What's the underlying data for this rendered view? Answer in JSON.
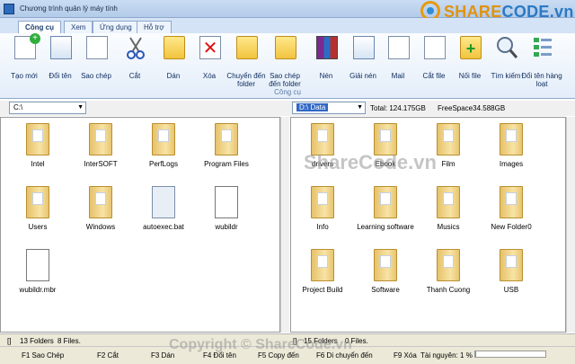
{
  "window": {
    "title": "Chương trình quản lý máy tính"
  },
  "logo": {
    "part1": "SHARE",
    "part2": "CODE",
    "part3": ".vn"
  },
  "tabs": [
    "Công cụ",
    "Xem",
    "Ứng dụng",
    "Hỗ trợ"
  ],
  "ribbon": {
    "group_label": "Công cụ",
    "buttons": [
      {
        "label": "Tạo mới",
        "icon": "new-document-icon"
      },
      {
        "label": "Đổi tên",
        "icon": "rename-icon"
      },
      {
        "label": "Sao chép",
        "icon": "copy-icon"
      },
      {
        "label": "Cắt",
        "icon": "scissors-icon"
      },
      {
        "label": "Dán",
        "icon": "paste-icon"
      },
      {
        "label": "Xóa",
        "icon": "delete-icon"
      },
      {
        "label": "Chuyển đến folder",
        "icon": "move-to-folder-icon"
      },
      {
        "label": "Sao chép đến folder",
        "icon": "copy-to-folder-icon"
      },
      {
        "label": "Nén",
        "icon": "compress-icon"
      },
      {
        "label": "Giải nén",
        "icon": "extract-icon"
      },
      {
        "label": "Mail",
        "icon": "mail-icon"
      },
      {
        "label": "Cắt file",
        "icon": "split-file-icon"
      },
      {
        "label": "Nối file",
        "icon": "join-file-icon"
      },
      {
        "label": "Tìm kiếm",
        "icon": "search-icon"
      },
      {
        "label": "Đổi tên hàng loạt",
        "icon": "batch-rename-icon"
      }
    ]
  },
  "left_pane": {
    "drive": "C:\\",
    "items": [
      {
        "name": "Intel",
        "type": "folder"
      },
      {
        "name": "InterSOFT",
        "type": "folder"
      },
      {
        "name": "PerfLogs",
        "type": "folder"
      },
      {
        "name": "Program Files",
        "type": "folder"
      },
      {
        "name": "Users",
        "type": "folder"
      },
      {
        "name": "Windows",
        "type": "folder"
      },
      {
        "name": "autoexec.bat",
        "type": "bat"
      },
      {
        "name": "wubildr",
        "type": "file"
      },
      {
        "name": "wubildr.mbr",
        "type": "file"
      }
    ],
    "status": {
      "bracket": "[]",
      "folders": "13 Folders",
      "files": "8 Files."
    }
  },
  "right_pane": {
    "drive": "D:\\  Data",
    "total": "Total: 124.175GB",
    "free": "FreeSpace34.588GB",
    "items": [
      {
        "name": "drivers",
        "type": "folder"
      },
      {
        "name": "Ebook",
        "type": "folder"
      },
      {
        "name": "Film",
        "type": "folder"
      },
      {
        "name": "Images",
        "type": "folder"
      },
      {
        "name": "Info",
        "type": "folder"
      },
      {
        "name": "Learning software",
        "type": "folder"
      },
      {
        "name": "Musics",
        "type": "folder"
      },
      {
        "name": "New Folder0",
        "type": "folder"
      },
      {
        "name": "Project Build",
        "type": "folder"
      },
      {
        "name": "Software",
        "type": "folder"
      },
      {
        "name": "Thanh Cuong",
        "type": "folder"
      },
      {
        "name": "USB",
        "type": "folder"
      }
    ],
    "status": {
      "bracket": "[]",
      "folders": "15 Folders",
      "files": "0 Files."
    }
  },
  "resource": {
    "label": "Tài nguyên: 1 %",
    "percent": 1
  },
  "fkeys": [
    "F1 Sao Chép",
    "F2 Cắt",
    "F3 Dán",
    "F4 Đổi tên",
    "F5 Copy đến",
    "F6 Di chuyển đến",
    "F9 Xóa"
  ],
  "watermarks": {
    "center": "ShareCode.vn",
    "bottom": "Copyright © ShareCode.vn"
  }
}
